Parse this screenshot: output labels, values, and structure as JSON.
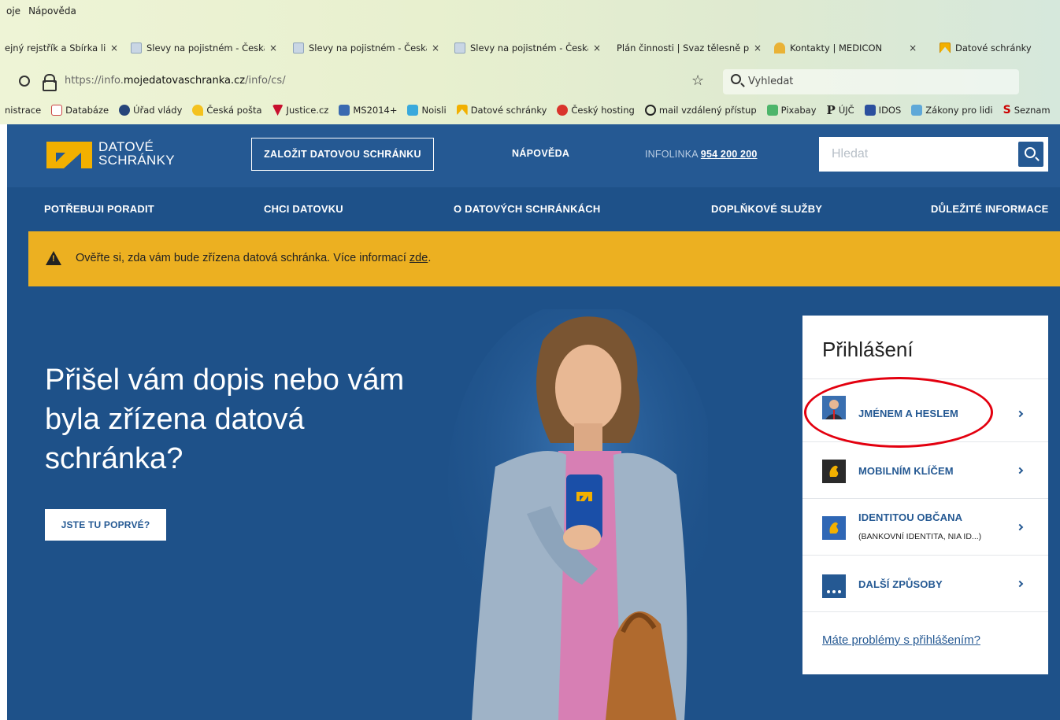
{
  "browser": {
    "menu": [
      "oje",
      "Nápověda"
    ],
    "tabs": [
      {
        "label": "ejný rejstřík a Sbírka listi",
        "close": "×"
      },
      {
        "label": "Slevy na pojistném - Česká",
        "close": "×"
      },
      {
        "label": "Slevy na pojistném - Česká",
        "close": "×"
      },
      {
        "label": "Slevy na pojistném - Česká",
        "close": "×"
      },
      {
        "label": "Plán činnosti | Svaz tělesně post",
        "close": "×"
      },
      {
        "label": "Kontakty | MEDICON",
        "close": "×"
      },
      {
        "label": "Datové schránky",
        "close": ""
      }
    ],
    "url_prefix": "https://info.",
    "url_domain": "mojedatovaschranka.cz",
    "url_path": "/info/cs/",
    "search_placeholder": "Vyhledat",
    "bookmarks": [
      "nistrace",
      "Databáze",
      "Úřad vlády",
      "Česká pošta",
      "Justice.cz",
      "MS2014+",
      "Noisli",
      "Datové schránky",
      "Český hosting",
      "mail vzdálený přístup",
      "Pixabay",
      "ÚJČ",
      "IDOS",
      "Zákony pro lidi",
      "Seznam"
    ]
  },
  "header": {
    "logo_line1": "DATOVÉ",
    "logo_line2": "SCHRÁNKY",
    "create_button": "ZALOŽIT DATOVOU SCHRÁNKU",
    "help": "NÁPOVĚDA",
    "infoline_label": "INFOLINKA",
    "infoline_number": "954 200 200",
    "search_placeholder": "Hledat"
  },
  "nav": [
    "POTŘEBUJI PORADIT",
    "CHCI DATOVKU",
    "O DATOVÝCH SCHRÁNKÁCH",
    "DOPLŇKOVÉ SLUŽBY",
    "DŮLEŽITÉ INFORMACE"
  ],
  "alert": {
    "text": "Ověřte si, zda vám bude zřízena datová schránka. Více informací ",
    "link": "zde",
    "suffix": "."
  },
  "hero": {
    "title": "Přišel vám dopis nebo vám byla zřízena datová schránka?",
    "button": "JSTE TU POPRVÉ?"
  },
  "login": {
    "title": "Přihlášení",
    "options": [
      {
        "label": "JMÉNEM A HESLEM",
        "sub": "",
        "icon": "user-icon"
      },
      {
        "label": "MOBILNÍM KLÍČEM",
        "sub": "",
        "icon": "lion-emblem-icon"
      },
      {
        "label": "IDENTITOU OBČANA",
        "sub": "(BANKOVNÍ IDENTITA, NIA ID...)",
        "icon": "lion-emblem-icon"
      },
      {
        "label": "DALŠÍ ZPŮSOBY",
        "sub": "",
        "icon": "more-dots-icon"
      }
    ],
    "problem_link": "Máte problémy s přihlášením?"
  },
  "colors": {
    "site_blue": "#1e5189",
    "header_blue": "#255993",
    "alert_yellow": "#ecb021",
    "logo_yellow": "#f2b000",
    "annotation_red": "#e3000f"
  }
}
